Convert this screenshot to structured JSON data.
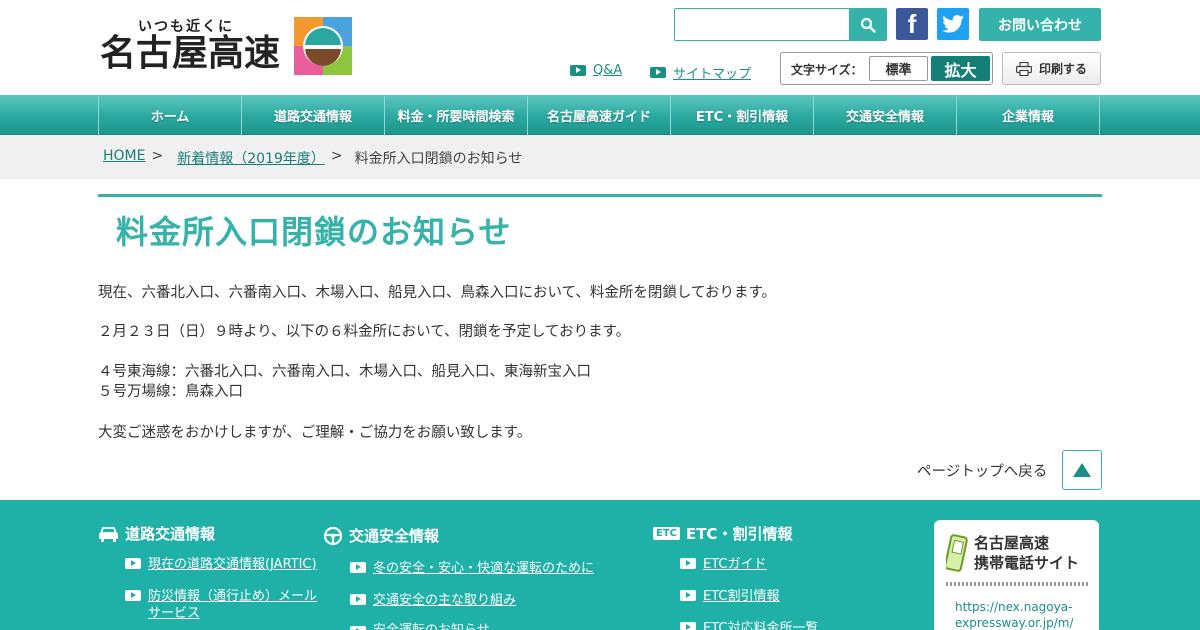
{
  "header": {
    "tagline": "いつも近くに",
    "logo_name": "名古屋高速",
    "search_placeholder": "",
    "contact_label": "お問い合わせ",
    "qa_label": "Q&A",
    "sitemap_label": "サイトマップ",
    "font_size_label": "文字サイズ：",
    "font_standard": "標準",
    "font_large": "拡大",
    "print_label": "印刷する",
    "accent_color": "#35b3aa"
  },
  "nav": {
    "items": [
      {
        "label": "ホーム"
      },
      {
        "label": "道路交通情報"
      },
      {
        "label": "料金・所要時間検索"
      },
      {
        "label": "名古屋高速ガイド"
      },
      {
        "label": "ETC・割引情報"
      },
      {
        "label": "交通安全情報"
      },
      {
        "label": "企業情報"
      }
    ]
  },
  "breadcrumb": {
    "home": "HOME",
    "sep": ">",
    "news": "新着情報（2019年度）",
    "current": "料金所入口閉鎖のお知らせ"
  },
  "main": {
    "title": "料金所入口閉鎖のお知らせ",
    "p1": "現在、六番北入口、六番南入口、木場入口、船見入口、鳥森入口において、料金所を閉鎖しております。",
    "p2": "２月２３日（日）９時より、以下の６料金所において、閉鎖を予定しております。",
    "p3a": "４号東海線：六番北入口、六番南入口、木場入口、船見入口、東海新宝入口",
    "p3b": "５号万場線：鳥森入口",
    "p4": "大変ご迷惑をおかけしますが、ご理解・ご協力をお願い致します。",
    "pagetop": "ページトップへ戻る"
  },
  "footer": {
    "col1": {
      "heading": "道路交通情報",
      "links": [
        "現在の道路交通情報(JARTIC)",
        "防災情報（通行止め）メール",
        "サービス"
      ]
    },
    "col2": {
      "heading": "交通安全情報",
      "links": [
        "冬の安全・安心・快適な運転のために",
        "交通安全の主な取り組み",
        "安全運転のお知らせ"
      ]
    },
    "col3": {
      "badge": "ETC",
      "heading": "ETC・割引情報",
      "links": [
        "ETCガイド",
        "ETC割引情報",
        "ETC対応料金所一覧"
      ]
    },
    "mobile": {
      "title_line1": "名古屋高速",
      "title_line2": "携帯電話サイト",
      "url_line1": "https://nex.nagoya-",
      "url_line2": "expressway.or.jp/m/"
    },
    "bg_color": "#1fb1a8"
  }
}
